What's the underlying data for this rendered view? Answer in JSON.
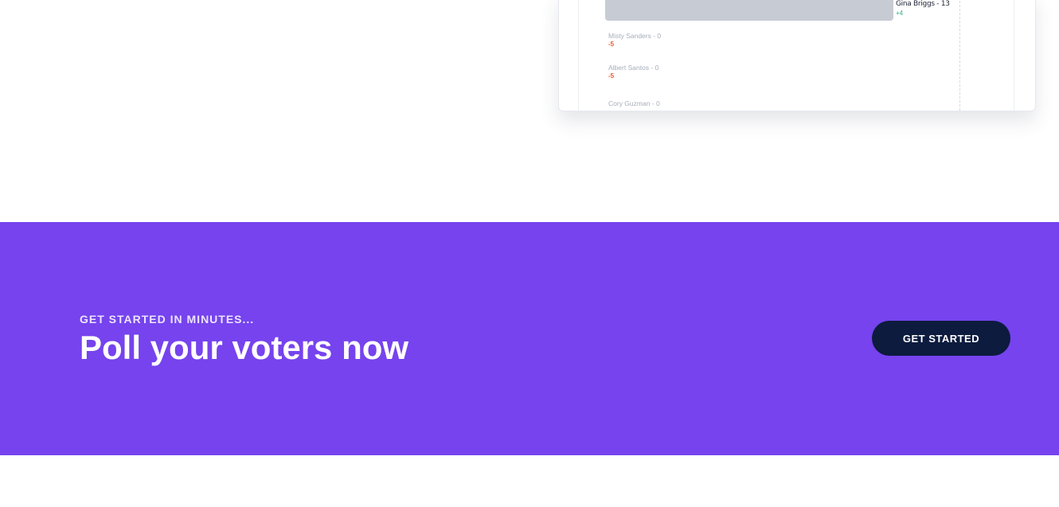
{
  "preview": {
    "leader": {
      "name": "Gina Briggs - 13",
      "delta": "+4"
    },
    "candidates": [
      {
        "name": "Misty Sanders - 0",
        "delta": "-5"
      },
      {
        "name": "Albert Santos - 0",
        "delta": "-5"
      },
      {
        "name": "Cory Guzman - 0",
        "delta": ""
      }
    ]
  },
  "cta": {
    "eyebrow": "GET STARTED IN MINUTES...",
    "headline": "Poll your voters now",
    "button_label": "GET STARTED"
  },
  "colors": {
    "band": "#7643ee",
    "button": "#0d1b3e",
    "positive": "#2eb08a",
    "negative": "#e8542f"
  }
}
